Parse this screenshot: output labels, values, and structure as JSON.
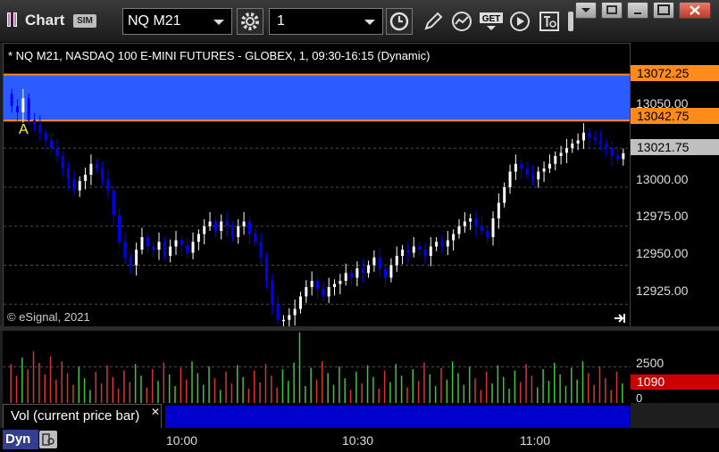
{
  "window": {
    "title": "Chart",
    "mode_badge": "SIM"
  },
  "toolbar": {
    "symbol": "NQ M21",
    "interval": "1",
    "get_label": "GET"
  },
  "chart": {
    "header": "* NQ M21, NASDAQ 100 E-MINI FUTURES - GLOBEX, 1, 09:30-16:15 (Dynamic)",
    "copyright": "© eSignal, 2021",
    "annotation": "A",
    "colors": {
      "up_candle": "#ffffff",
      "down_candle": "#0000ff",
      "range_band": "#2b5cff",
      "range_border": "#ff8c1a",
      "last_price": "#c0c0c0",
      "volume_up": "#3ec33e",
      "volume_down": "#d63434",
      "volume_marker": "#cc0000"
    }
  },
  "price_axis": {
    "ticks": [
      "13050.00",
      "13000.00",
      "12975.00",
      "12950.00",
      "12925.00"
    ],
    "range_high": "13072.25",
    "range_low": "13042.75",
    "last_price": "13021.75"
  },
  "volume": {
    "study_label": "Vol (current price bar)",
    "ticks": [
      "2500",
      "0"
    ],
    "current_volume": "1090"
  },
  "time_axis": {
    "labels": [
      "10:00",
      "10:30",
      "11:00"
    ],
    "mode_button": "Dyn"
  },
  "chart_data": {
    "type": "candlestick",
    "title": "* NQ M21, NASDAQ 100 E-MINI FUTURES - GLOBEX, 1, 09:30-16:15 (Dynamic)",
    "ylim": [
      12908,
      13092
    ],
    "x_labels": [
      "10:00",
      "10:30",
      "11:00"
    ],
    "closes": [
      13052,
      13048,
      13057,
      13043,
      13040,
      13035,
      13030,
      13025,
      13020,
      13012,
      13005,
      12998,
      13004,
      13008,
      13015,
      13012,
      13005,
      12998,
      12982,
      12965,
      12955,
      12950,
      12960,
      12968,
      12962,
      12960,
      12965,
      12956,
      12962,
      12966,
      12963,
      12958,
      12965,
      12970,
      12975,
      12978,
      12972,
      12978,
      12975,
      12968,
      12975,
      12978,
      12970,
      12965,
      12955,
      12940,
      12925,
      12915,
      12915,
      12918,
      12922,
      12930,
      12936,
      12940,
      12935,
      12930,
      12936,
      12938,
      12940,
      12945,
      12942,
      12948,
      12945,
      12950,
      12955,
      12948,
      12942,
      12950,
      12956,
      12960,
      12958,
      12962,
      12960,
      12956,
      12962,
      12965,
      12962,
      12966,
      12970,
      12975,
      12978,
      12980,
      12975,
      12972,
      12968,
      12980,
      12990,
      13000,
      13010,
      13015,
      13012,
      13008,
      13005,
      13010,
      13012,
      13015,
      13020,
      13022,
      13025,
      13028,
      13030,
      13035,
      13032,
      13030,
      13028,
      13025,
      13020,
      13018,
      13021.75
    ],
    "range_band": [
      13042.75,
      13072.25
    ],
    "last_price": 13021.75,
    "volume": {
      "ylim": [
        0,
        5000
      ],
      "current": 1090,
      "tick_values": [
        2500,
        0
      ]
    }
  }
}
